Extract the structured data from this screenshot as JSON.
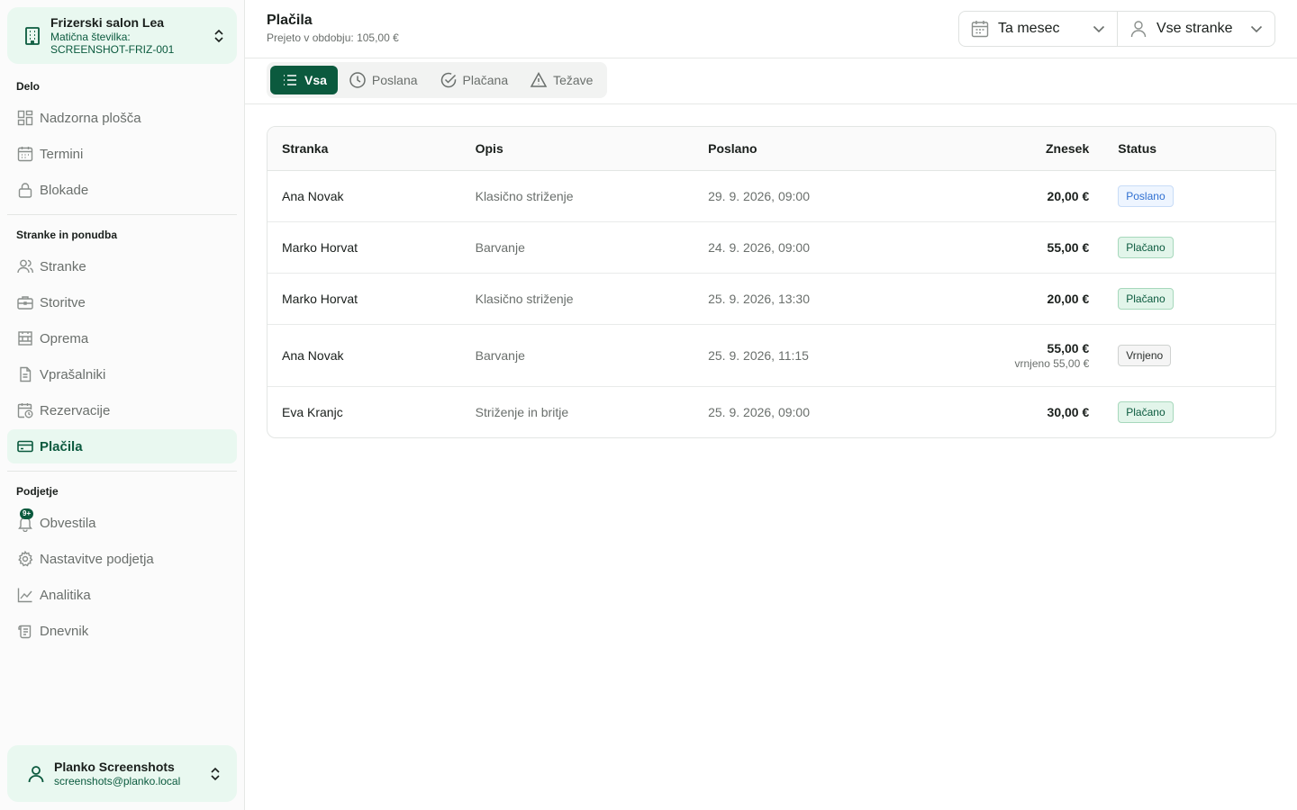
{
  "org": {
    "name": "Frizerski salon Lea",
    "id_label": "Matična številka:",
    "id_value": "SCREENSHOT-FRIZ-001"
  },
  "sidebar": {
    "sections": [
      {
        "title": "Delo"
      },
      {
        "title": "Stranke in ponudba"
      },
      {
        "title": "Podjetje"
      }
    ],
    "items": [
      {
        "label": "Nadzorna plošča",
        "icon": "dashboard-icon"
      },
      {
        "label": "Termini",
        "icon": "calendar-icon"
      },
      {
        "label": "Blokade",
        "icon": "lock-icon"
      },
      {
        "label": "Stranke",
        "icon": "users-icon"
      },
      {
        "label": "Storitve",
        "icon": "briefcase-icon"
      },
      {
        "label": "Oprema",
        "icon": "equipment-icon"
      },
      {
        "label": "Vprašalniki",
        "icon": "document-icon"
      },
      {
        "label": "Rezervacije",
        "icon": "calendar-clock-icon"
      },
      {
        "label": "Plačila",
        "icon": "credit-card-icon",
        "active": true
      },
      {
        "label": "Obvestila",
        "icon": "bell-icon",
        "badge": "9+"
      },
      {
        "label": "Nastavitve podjetja",
        "icon": "gear-icon"
      },
      {
        "label": "Analitika",
        "icon": "chart-icon"
      },
      {
        "label": "Dnevnik",
        "icon": "scroll-icon"
      }
    ]
  },
  "user": {
    "name": "Planko Screenshots",
    "email": "screenshots@planko.local"
  },
  "page": {
    "title": "Plačila",
    "subtitle": "Prejeto v obdobju: 105,00 €"
  },
  "filters": {
    "period": "Ta mesec",
    "clients": "Vse stranke"
  },
  "tabs": [
    {
      "label": "Vsa",
      "icon": "list-icon",
      "active": true
    },
    {
      "label": "Poslana",
      "icon": "clock-icon"
    },
    {
      "label": "Plačana",
      "icon": "check-circle-icon"
    },
    {
      "label": "Težave",
      "icon": "warning-icon"
    }
  ],
  "table": {
    "headers": {
      "client": "Stranka",
      "description": "Opis",
      "sent": "Poslano",
      "amount": "Znesek",
      "status": "Status"
    },
    "rows": [
      {
        "client": "Ana Novak",
        "description": "Klasično striženje",
        "sent": "29. 9. 2026, 09:00",
        "amount": "20,00 €",
        "note": "",
        "status": "Poslano",
        "status_kind": "sent"
      },
      {
        "client": "Marko Horvat",
        "description": "Barvanje",
        "sent": "24. 9. 2026, 09:00",
        "amount": "55,00 €",
        "note": "",
        "status": "Plačano",
        "status_kind": "paid"
      },
      {
        "client": "Marko Horvat",
        "description": "Klasično striženje",
        "sent": "25. 9. 2026, 13:30",
        "amount": "20,00 €",
        "note": "",
        "status": "Plačano",
        "status_kind": "paid"
      },
      {
        "client": "Ana Novak",
        "description": "Barvanje",
        "sent": "25. 9. 2026, 11:15",
        "amount": "55,00 €",
        "note": "vrnjeno 55,00 €",
        "status": "Vrnjeno",
        "status_kind": "refund"
      },
      {
        "client": "Eva Kranjc",
        "description": "Striženje in britje",
        "sent": "25. 9. 2026, 09:00",
        "amount": "30,00 €",
        "note": "",
        "status": "Plačano",
        "status_kind": "paid"
      }
    ]
  }
}
